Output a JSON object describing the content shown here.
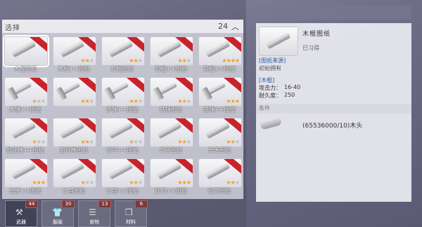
{
  "left": {
    "title": "选择",
    "count": "24",
    "chevron": "^",
    "items": [
      {
        "label": "木棍图纸",
        "stars": 0,
        "selected": true,
        "kind": "stick"
      },
      {
        "label": "木棍++图纸",
        "stars": 2,
        "kind": "stick"
      },
      {
        "label": "钓棍图纸",
        "stars": 2,
        "kind": "stick"
      },
      {
        "label": "钓棍++图纸",
        "stars": 2,
        "kind": "stick"
      },
      {
        "label": "警棍++图纸",
        "stars": 4,
        "kind": "stick"
      },
      {
        "label": "木锤++图纸",
        "stars": 1,
        "kind": "hammer"
      },
      {
        "label": "",
        "stars": 2,
        "kind": "hammer"
      },
      {
        "label": "手锤++图纸",
        "stars": 2,
        "kind": "hammer"
      },
      {
        "label": "铁锤图纸",
        "stars": 2,
        "kind": "hammer"
      },
      {
        "label": "铁锤++图纸",
        "stars": 3,
        "kind": "hammer"
      },
      {
        "label": "狼牙棒++图纸",
        "stars": 1,
        "kind": "stick"
      },
      {
        "label": "狼牙棒图纸",
        "stars": 2,
        "kind": "stick"
      },
      {
        "label": "斧子++图纸",
        "stars": 1,
        "kind": "stick"
      },
      {
        "label": "斧子图纸",
        "stars": 2,
        "kind": "stick"
      },
      {
        "label": "长矛图纸",
        "stars": 2,
        "kind": "stick"
      },
      {
        "label": "长矛++图纸",
        "stars": 3,
        "kind": "stick"
      },
      {
        "label": "匕首图纸",
        "stars": 1,
        "kind": "stick"
      },
      {
        "label": "匕首++图纸",
        "stars": 2,
        "kind": "stick"
      },
      {
        "label": "砍刀++图纸",
        "stars": 3,
        "kind": "stick"
      },
      {
        "label": "砍刀图纸",
        "stars": 2,
        "kind": "stick"
      }
    ],
    "tabs": [
      {
        "label": "武器",
        "badge": "44",
        "icon": "axe-icon",
        "glyph": "⚒"
      },
      {
        "label": "服装",
        "badge": "30",
        "icon": "shirt-icon",
        "glyph": "👕"
      },
      {
        "label": "食物",
        "badge": "13",
        "icon": "food-icon",
        "glyph": "☰"
      },
      {
        "label": "材料",
        "badge": "6",
        "icon": "material-icon",
        "glyph": "❒"
      }
    ]
  },
  "detail": {
    "name": "木棍图纸",
    "status": "已习得",
    "source_title": "[图纸来源]",
    "source_value": "初始拥有",
    "category": "[木棍]",
    "stats": [
      {
        "label": "攻击力：",
        "value": "16-40"
      },
      {
        "label": "耐久度：",
        "value": "250"
      }
    ],
    "section_title": "条件",
    "materials": [
      {
        "text": "(65536000/10)木头"
      }
    ]
  },
  "colors": {
    "ribbon": "#c8232c",
    "star": "#f0a020",
    "source": "#2a5da8"
  }
}
